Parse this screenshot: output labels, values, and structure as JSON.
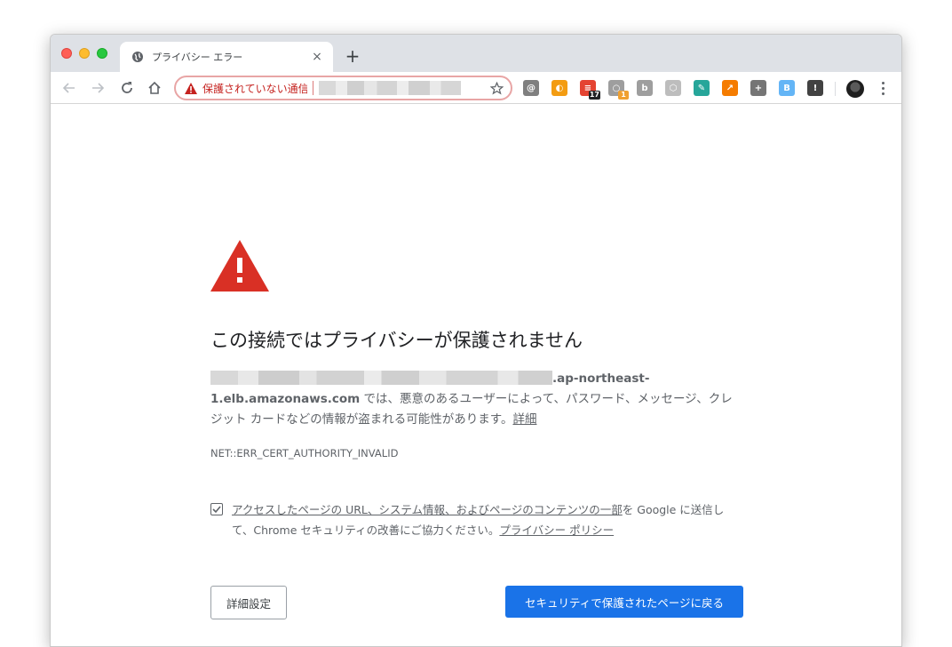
{
  "tab": {
    "title": "プライバシー エラー",
    "close_label": "×"
  },
  "new_tab_label": "+",
  "omnibox": {
    "security_label": "保護されていない通信"
  },
  "extensions": [
    {
      "name": "ext-1-icon",
      "color": "#7f7f7f",
      "glyph": "@"
    },
    {
      "name": "ext-2-icon",
      "color": "#f39c12",
      "glyph": "◐"
    },
    {
      "name": "ext-todoist-icon",
      "color": "#e44332",
      "glyph": "≡",
      "badge": "17",
      "badge_color": "#202124"
    },
    {
      "name": "ext-4-icon",
      "color": "#9e9e9e",
      "glyph": "○",
      "badge": "1",
      "badge_color": "#f0a030"
    },
    {
      "name": "ext-b-icon",
      "color": "#9e9e9e",
      "glyph": "b"
    },
    {
      "name": "ext-6-icon",
      "color": "#bdbdbd",
      "glyph": "⬡"
    },
    {
      "name": "ext-7-icon",
      "color": "#26a69a",
      "glyph": "✎"
    },
    {
      "name": "ext-8-icon",
      "color": "#f57c00",
      "glyph": "↗"
    },
    {
      "name": "ext-9-icon",
      "color": "#757575",
      "glyph": "+"
    },
    {
      "name": "ext-10-icon",
      "color": "#64b5f6",
      "glyph": "B"
    },
    {
      "name": "ext-11-icon",
      "color": "#424242",
      "glyph": "!"
    }
  ],
  "error_page": {
    "heading": "この接続ではプライバシーが保護されません",
    "host_bold_1": ".ap-northeast-",
    "host_bold_2": "1.elb.amazonaws.com",
    "description": " では、悪意のあるユーザーによって、パスワード、メッセージ、クレジット カードなどの情報が盗まれる可能性があります。",
    "details_link": "詳細",
    "error_code": "NET::ERR_CERT_AUTHORITY_INVALID",
    "checkbox_text_underlined": "アクセスしたページの URL、システム情報、およびページのコンテンツの一部",
    "checkbox_text_rest": "を Google に送信して、Chrome セキュリティの改善にご協力ください。",
    "privacy_policy_link": "プライバシー ポリシー",
    "advanced_button": "詳細設定",
    "back_button": "セキュリティで保護されたページに戻る"
  },
  "colors": {
    "accent": "#1a73e8",
    "danger": "#d93025"
  }
}
